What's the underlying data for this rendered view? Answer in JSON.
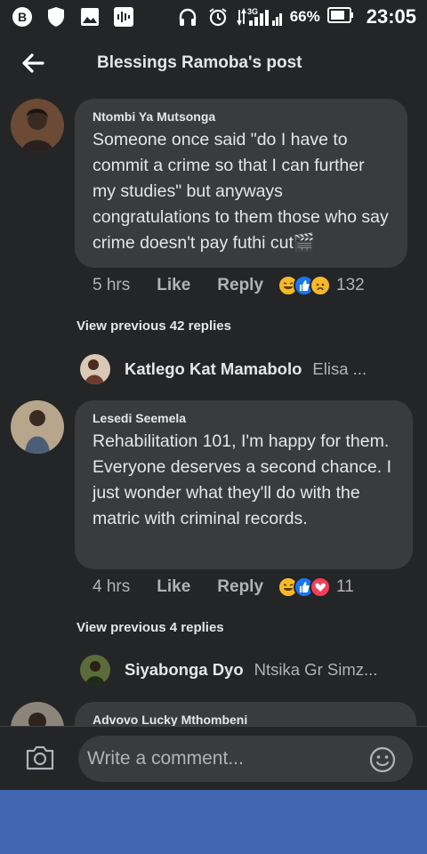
{
  "status_bar": {
    "network": "3G",
    "battery": "66%",
    "time": "23:05"
  },
  "header": {
    "title": "Blessings Ramoba's post"
  },
  "comments": [
    {
      "author": "Ntombi Ya Mutsonga",
      "text": "Someone once said \"do I have to commit a crime so that I can further my studies\" but anyways congratulations to them those who say crime doesn't pay futhi cut🎬",
      "time": "5 hrs",
      "like_label": "Like",
      "reply_label": "Reply",
      "reaction_count": "132",
      "reactions": [
        "haha",
        "like",
        "sad"
      ]
    },
    {
      "author": "Lesedi Seemela",
      "text": "Rehabilitation 101, I'm happy for them. Everyone deserves a second chance. I just wonder what they'll do with the matric with criminal records.",
      "time": "4 hrs",
      "like_label": "Like",
      "reply_label": "Reply",
      "reaction_count": "11",
      "reactions": [
        "haha",
        "like",
        "love"
      ]
    },
    {
      "author": "Advovo Lucky Mthombeni"
    }
  ],
  "view_previous": [
    {
      "label": "View previous 42 replies"
    },
    {
      "label": "View previous 4 replies"
    }
  ],
  "reply_previews": [
    {
      "name": "Katlego Kat Mamabolo",
      "snippet": "Elisa ..."
    },
    {
      "name": "Siyabonga Dyo",
      "snippet": "Ntsika Gr Simz..."
    }
  ],
  "comment_bar": {
    "placeholder": "Write a comment..."
  },
  "colors": {
    "background": "#242526",
    "bubble": "#3a3b3c",
    "bottom_band": "#4267b2",
    "like_blue": "#1877f2",
    "haha_yellow": "#f7b928",
    "love_red": "#f33e58"
  }
}
